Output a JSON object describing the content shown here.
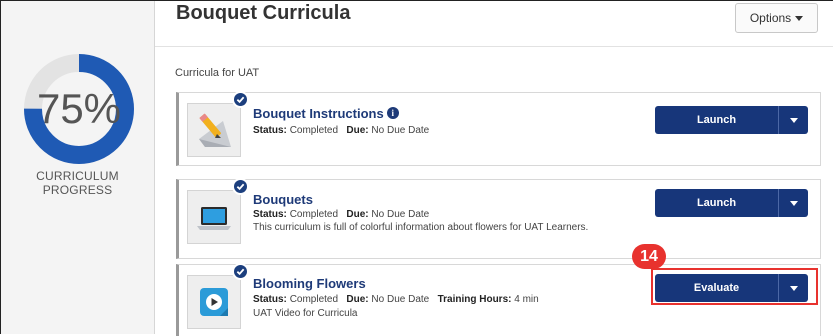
{
  "progress": {
    "percent_text": "75%",
    "fraction": 0.75,
    "label": "CURRICULUM PROGRESS",
    "ring_color": "#1f5ab4",
    "track_color": "#e3e3e3"
  },
  "header": {
    "title": "Bouquet Curricula",
    "options_label": "Options"
  },
  "section_label": "Curricula for UAT",
  "items": [
    {
      "title": "Bouquet Instructions",
      "status_label": "Status:",
      "status": "Completed",
      "due_label": "Due:",
      "due": "No Due Date",
      "action": "Launch",
      "icon": "pencil-document-icon"
    },
    {
      "title": "Bouquets",
      "status_label": "Status:",
      "status": "Completed",
      "due_label": "Due:",
      "due": "No Due Date",
      "description": "This curriculum is full of colorful information about flowers for UAT Learners.",
      "action": "Launch",
      "icon": "laptop-icon"
    },
    {
      "title": "Blooming Flowers",
      "status_label": "Status:",
      "status": "Completed",
      "due_label": "Due:",
      "due": "No Due Date",
      "hours_label": "Training Hours:",
      "hours": "4 min",
      "description": "UAT Video for Curricula",
      "action": "Evaluate",
      "icon": "video-play-icon"
    }
  ],
  "annotation": {
    "step": "14",
    "color": "#e8322e"
  },
  "accent": "#17367a"
}
